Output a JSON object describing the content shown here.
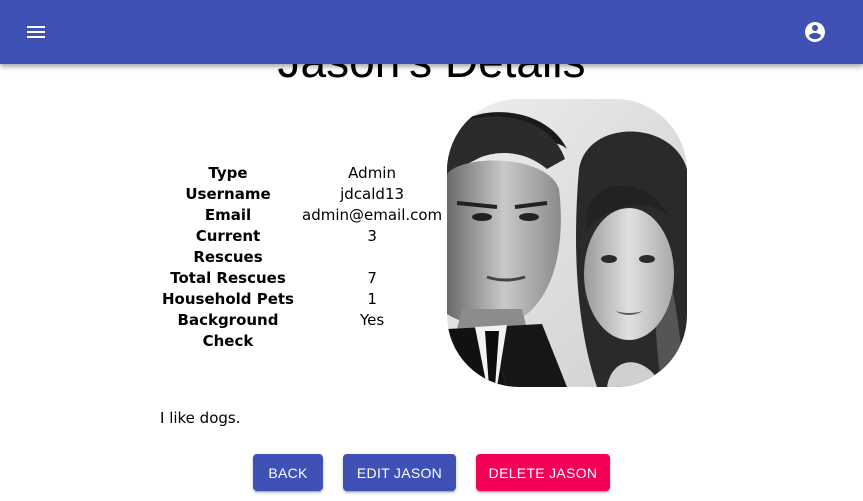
{
  "appbar": {
    "menu_icon": "hamburger-menu-icon",
    "account_icon": "account-circle-icon",
    "color": "#3f51b5"
  },
  "page": {
    "title": "Jason's Details",
    "bio": "I like dogs."
  },
  "details": [
    {
      "label": "Type",
      "value": "Admin"
    },
    {
      "label": "Username",
      "value": "jdcald13"
    },
    {
      "label": "Email",
      "value": "admin@email.com"
    },
    {
      "label": "Current Rescues",
      "value": "3"
    },
    {
      "label": "Total Rescues",
      "value": "7"
    },
    {
      "label": "Household Pets",
      "value": "1"
    },
    {
      "label": "Background Check",
      "value": "Yes"
    }
  ],
  "actions": {
    "back_label": "BACK",
    "edit_label": "EDIT JASON",
    "delete_label": "DELETE JASON",
    "primary_color": "#3f51b5",
    "danger_color": "#f50057"
  }
}
